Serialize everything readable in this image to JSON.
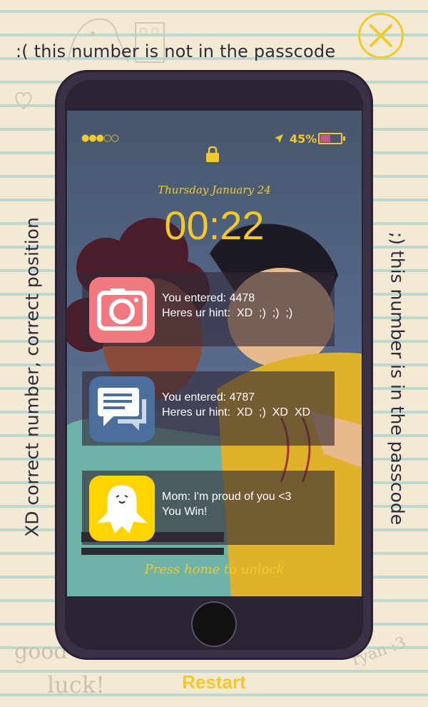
{
  "hints": {
    "top": ":( this number is not in the passcode",
    "left": "XD correct number, correct position",
    "right": ";) this number is in the passcode"
  },
  "doodles": {
    "good": "good",
    "luck": "luck!",
    "signature": "ryan :3"
  },
  "lock_screen": {
    "signal": "●●●○○",
    "battery": "45%",
    "battery_level": 0.45,
    "date": "Thursday January 24",
    "time": "00:22",
    "press_home": "Press home to unlock"
  },
  "notifications": [
    {
      "app": "camera-app-icon",
      "color": "#f2797f",
      "line1": "You entered: 4478",
      "line2": "Heres ur hint:  XD  ;)  ;)  ;)"
    },
    {
      "app": "messages-app-icon",
      "color": "#4a6f9c",
      "line1": "You entered: 4787",
      "line2": "Heres ur hint:  XD  ;)  XD  XD"
    },
    {
      "app": "ghost-app-icon",
      "color": "#ffd400",
      "line1": "Mom: I'm proud of you <3",
      "line2": "You Win!"
    }
  ],
  "restart_label": "Restart",
  "colors": {
    "accent": "#f2c82a",
    "phone": "#3b3147"
  }
}
